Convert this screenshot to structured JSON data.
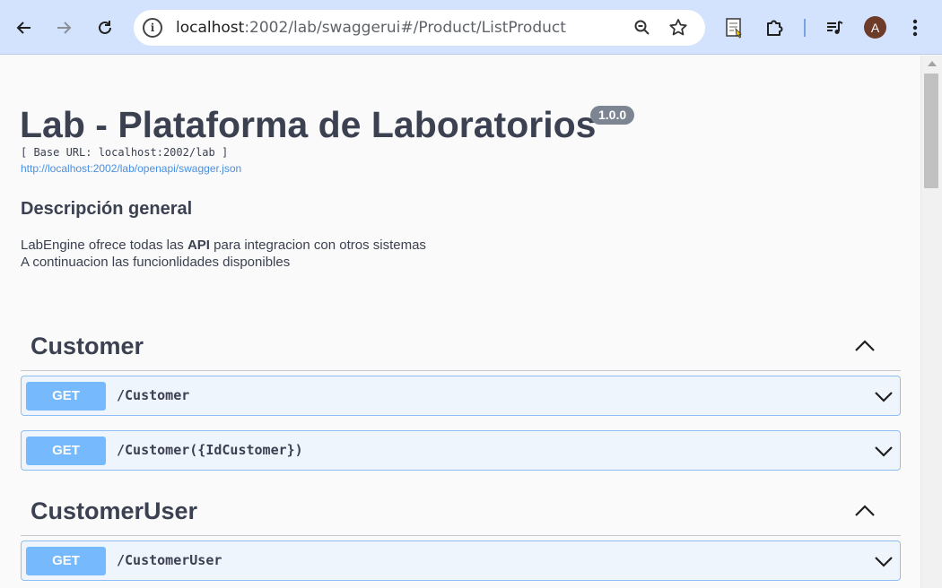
{
  "browser": {
    "url_host": "localhost",
    "url_rest": ":2002/lab/swaggerui#/Product/ListProduct",
    "profile_initial": "A"
  },
  "api": {
    "title": "Lab - Plataforma de Laboratorios",
    "version": "1.0.0",
    "base_url": "[ Base URL: localhost:2002/lab ]",
    "spec_link": "http://localhost:2002/lab/openapi/swagger.json",
    "description_heading": "Descripción general",
    "description_line1_pre": "LabEngine ofrece todas las ",
    "description_line1_bold": "API",
    "description_line1_post": " para integracion con otros sistemas",
    "description_line2": "A continuacion las funcionlidades disponibles"
  },
  "tags": [
    {
      "name": "Customer",
      "operations": [
        {
          "method": "GET",
          "path": "/Customer"
        },
        {
          "method": "GET",
          "path": "/Customer({IdCustomer})"
        }
      ]
    },
    {
      "name": "CustomerUser",
      "operations": [
        {
          "method": "GET",
          "path": "/CustomerUser"
        }
      ]
    }
  ],
  "colors": {
    "toolbar_bg": "#d3e3fd",
    "get_method": "#61affe",
    "get_block_bg": "#eff5fd",
    "text_primary": "#3b4151",
    "link": "#4990e2"
  }
}
